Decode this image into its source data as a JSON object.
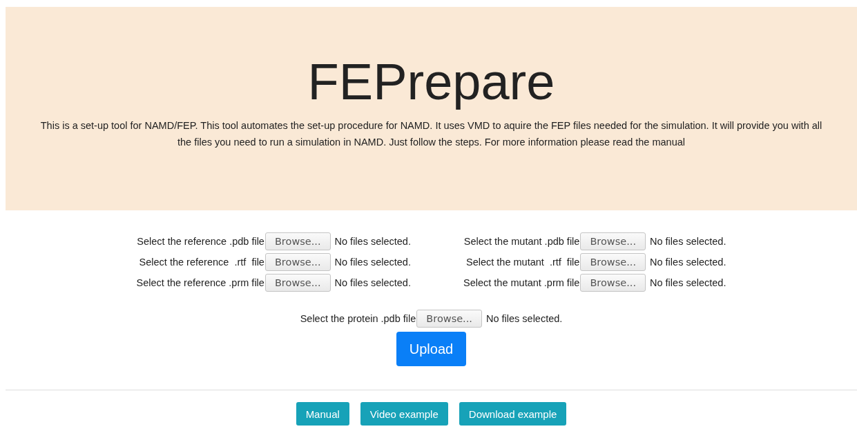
{
  "header": {
    "title": "FEPrepare",
    "description": "This is a set-up tool for NAMD/FEP. This tool automates the set-up procedure for NAMD. It uses VMD to aquire the FEP files needed for the simulation. It will provide you with all the files you need to run a simulation in NAMD. Just follow the steps. For more information please read the manual"
  },
  "file_columns": [
    [
      {
        "label": "Select the reference .pdb file",
        "button": "Browse...",
        "status": "No files selected."
      },
      {
        "label": "Select the reference  .rtf  file",
        "button": "Browse...",
        "status": "No files selected."
      },
      {
        "label": "Select the reference .prm file",
        "button": "Browse...",
        "status": "No files selected."
      }
    ],
    [
      {
        "label": "Select the mutant .pdb file",
        "button": "Browse...",
        "status": "No files selected."
      },
      {
        "label": "Select the mutant  .rtf  file",
        "button": "Browse...",
        "status": "No files selected."
      },
      {
        "label": "Select the mutant .prm file",
        "button": "Browse...",
        "status": "No files selected."
      }
    ]
  ],
  "protein_file": {
    "label": "Select the protein .pdb file",
    "button": "Browse...",
    "status": "No files selected."
  },
  "upload_button": "Upload",
  "footer_buttons": [
    "Manual",
    "Video example",
    "Download example"
  ]
}
